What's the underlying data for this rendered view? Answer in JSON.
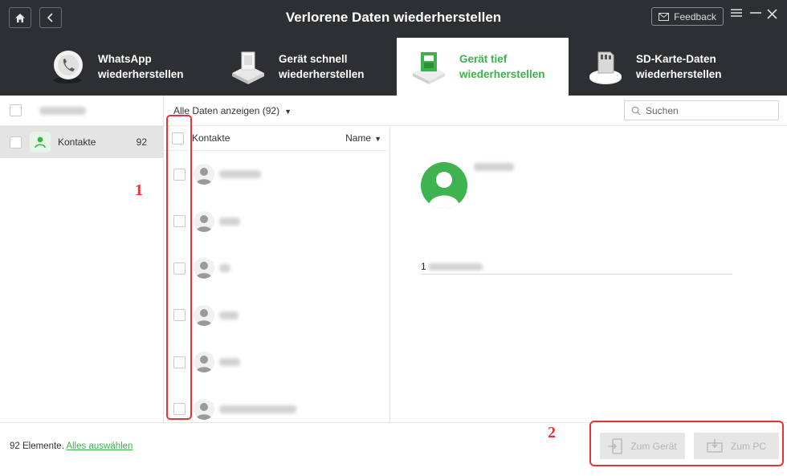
{
  "titlebar": {
    "title": "Verlorene Daten wiederherstellen",
    "feedback_label": "Feedback",
    "home_icon": "home-icon",
    "back_icon": "chevron-left-icon"
  },
  "modes": [
    {
      "line1": "WhatsApp",
      "line2": "wiederherstellen",
      "active": false
    },
    {
      "line1": "Gerät schnell",
      "line2": "wiederherstellen",
      "active": false
    },
    {
      "line1": "Gerät tief",
      "line2": "wiederherstellen",
      "active": true
    },
    {
      "line1": "SD-Karte-Daten",
      "line2": "wiederherstellen",
      "active": false
    }
  ],
  "sidebar": {
    "category_label": "Kontakte",
    "category_count": "92"
  },
  "filter": {
    "dropdown_label": "Alle Daten anzeigen (92)",
    "search_placeholder": "Suchen"
  },
  "list": {
    "header_label": "Kontakte",
    "sort_label": "Name"
  },
  "detail": {
    "phone": "1"
  },
  "bottom": {
    "count_text": "92 Elemente.",
    "select_all": "Alles auswählen",
    "to_device": "Zum Gerät",
    "to_pc": "Zum PC"
  },
  "annotations": {
    "one": "1",
    "two": "2"
  },
  "colors": {
    "accent": "#3bb34a",
    "titlebar_bg": "#2e2f32",
    "annotation_red": "#e8323a"
  }
}
